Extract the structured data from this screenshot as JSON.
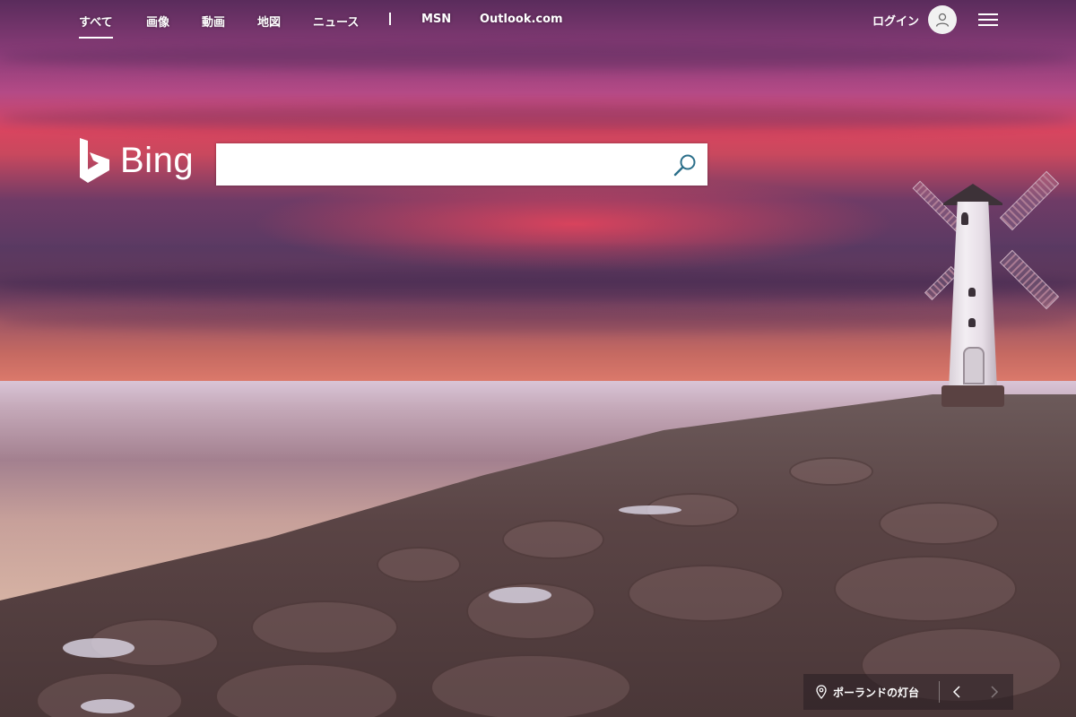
{
  "nav": {
    "items": [
      {
        "label": "すべて",
        "active": true
      },
      {
        "label": "画像"
      },
      {
        "label": "動画"
      },
      {
        "label": "地図"
      },
      {
        "label": "ニュース"
      }
    ],
    "external": [
      {
        "label": "MSN"
      },
      {
        "label": "Outlook.com"
      }
    ]
  },
  "account": {
    "login_label": "ログイン",
    "avatar_icon": "user-icon",
    "menu_icon": "hamburger-menu-icon"
  },
  "logo": {
    "text": "Bing",
    "icon": "bing-b-icon"
  },
  "search": {
    "value": "",
    "placeholder": "",
    "button_icon": "search-icon",
    "icon_color": "#2b6f8a"
  },
  "image_info": {
    "title": "ポーランドの灯台",
    "pin_icon": "location-pin-icon",
    "prev_icon": "chevron-left-icon",
    "next_icon": "chevron-right-icon"
  }
}
